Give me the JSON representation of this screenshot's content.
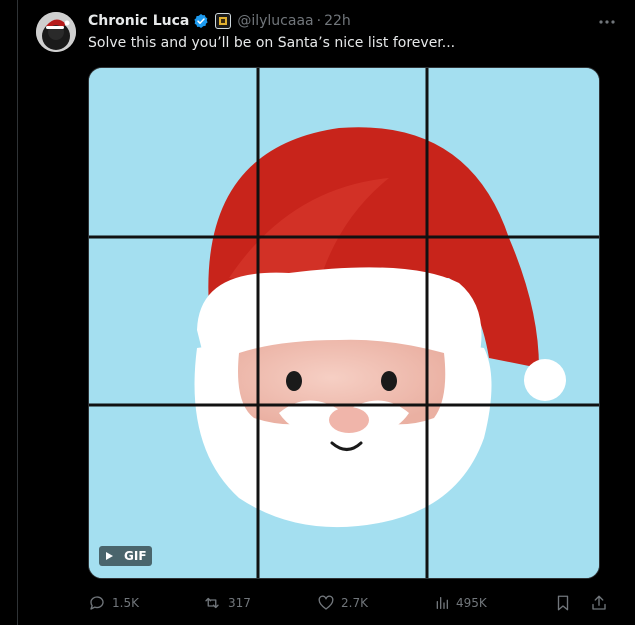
{
  "post": {
    "author": {
      "display_name": "Chronic Luca",
      "handle": "@ilylucaaa",
      "time": "22h",
      "separator": "·"
    },
    "text": "Solve this and you’ll be on Santa’s nice list forever...",
    "media": {
      "badge_label": "GIF"
    },
    "actions": {
      "replies": "1.5K",
      "reposts": "317",
      "likes": "2.7K",
      "views": "495K"
    }
  },
  "colors": {
    "background": "#000000",
    "sky": "#a4dff0",
    "hat_red": "#c8241b",
    "verified_blue": "#1d9bf0",
    "muted_text": "#71767b"
  },
  "icons": {
    "more": "more-dots-icon",
    "reply": "reply-icon",
    "repost": "repost-icon",
    "like": "heart-icon",
    "views": "views-icon",
    "bookmark": "bookmark-icon",
    "share": "share-icon",
    "verified": "verified-badge-icon",
    "play": "play-icon"
  }
}
